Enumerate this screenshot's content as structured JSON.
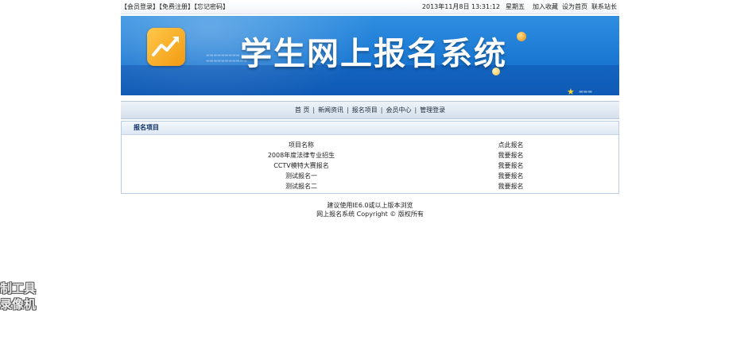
{
  "topbar": {
    "links": [
      "【会员登录】",
      "【免费注册】",
      "【忘记密码】"
    ],
    "datetime": "2013年11月8日  13:31:12",
    "weekday": "星期五",
    "right_links": [
      "加入收藏",
      "设为首页",
      "联系站长"
    ]
  },
  "banner": {
    "title": "学生网上报名系统"
  },
  "nav": {
    "items": [
      "首 页",
      "新闻资讯",
      "报名项目",
      "会员中心",
      "管理登录"
    ]
  },
  "panel": {
    "title": "报名项目",
    "headers": {
      "name": "项目名称",
      "action": "点此报名"
    },
    "rows": [
      {
        "name": "2008年度法律专业招生",
        "action": "我要报名"
      },
      {
        "name": "CCTV模特大赛报名",
        "action": "我要报名"
      },
      {
        "name": "测试报名一",
        "action": "我要报名"
      },
      {
        "name": "测试报名二",
        "action": "我要报名"
      }
    ]
  },
  "footer": {
    "line1": "建议使用IE6.0或以上版本浏览",
    "line2": "网上报名系统 Copyright © 版权所有"
  },
  "watermark": {
    "line1": "制工具",
    "line2": "录像机"
  }
}
